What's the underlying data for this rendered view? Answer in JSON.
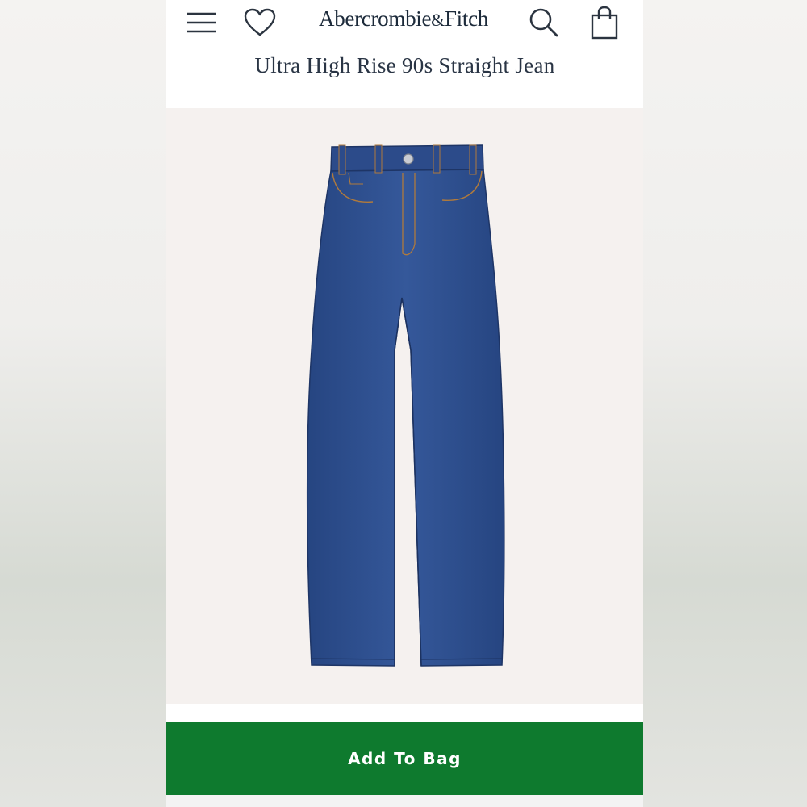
{
  "header": {
    "brand_main": "Abercrombie",
    "brand_amp": "&",
    "brand_end": "Fitch",
    "icons": [
      "hamburger-menu-icon",
      "heart-icon",
      "search-icon",
      "shopping-bag-icon"
    ]
  },
  "product": {
    "title": "Ultra High Rise 90s Straight Jean",
    "image_subject": "dark wash straight leg jeans"
  },
  "actions": {
    "add_to_bag_label": "Add To Bag"
  },
  "colors": {
    "brand_green": "#0e7a2e",
    "text_navy": "#1c2a3a",
    "denim": "#2f4f8f",
    "image_bg": "#f5f1ef"
  }
}
